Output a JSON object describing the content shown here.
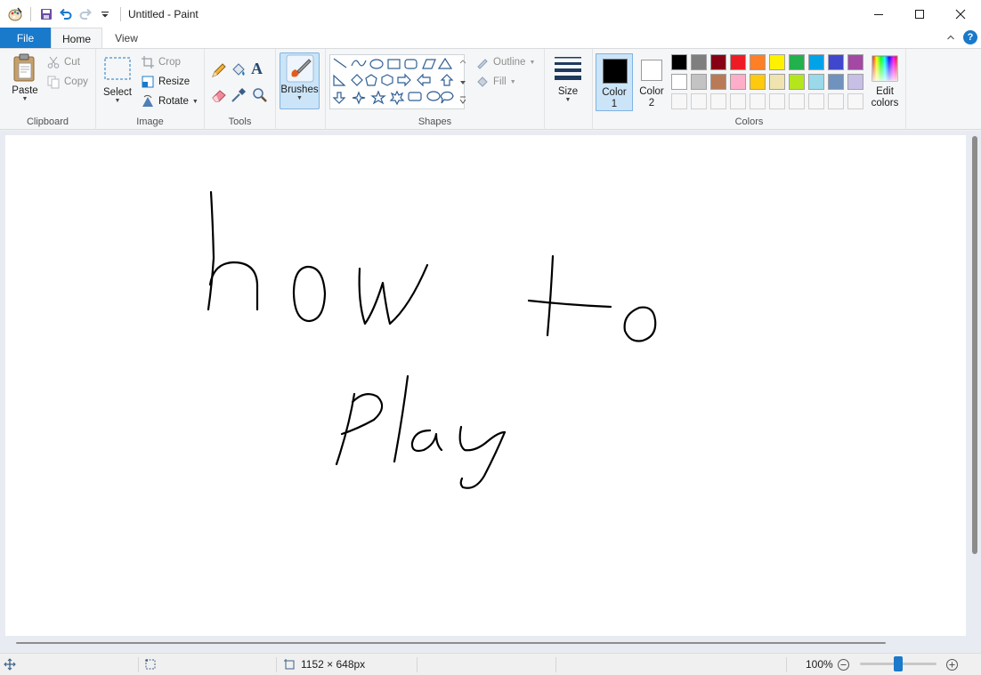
{
  "window": {
    "title": "Untitled - Paint"
  },
  "tabs": {
    "file": "File",
    "home": "Home",
    "view": "View"
  },
  "ribbon": {
    "clipboard": {
      "label": "Clipboard",
      "paste": "Paste",
      "cut": "Cut",
      "copy": "Copy"
    },
    "image": {
      "label": "Image",
      "select": "Select",
      "crop": "Crop",
      "resize": "Resize",
      "rotate": "Rotate"
    },
    "tools": {
      "label": "Tools"
    },
    "brushes": {
      "label": "Brushes"
    },
    "shapes": {
      "label": "Shapes",
      "outline": "Outline",
      "fill": "Fill"
    },
    "size": {
      "label": "Size"
    },
    "colors": {
      "label": "Colors",
      "color1_line1": "Color",
      "color1_line2": "1",
      "color2_line1": "Color",
      "color2_line2": "2",
      "edit_line1": "Edit",
      "edit_line2": "colors",
      "color1_value": "#000000",
      "color2_value": "#ffffff",
      "palette_row1": [
        "#000000",
        "#7f7f7f",
        "#880015",
        "#ed1c24",
        "#ff7f27",
        "#fff200",
        "#22b14c",
        "#00a2e8",
        "#3f48cc",
        "#a349a4"
      ],
      "palette_row2": [
        "#ffffff",
        "#c3c3c3",
        "#b97a57",
        "#ffaec9",
        "#ffc90e",
        "#efe4b0",
        "#b5e61d",
        "#99d9ea",
        "#7092be",
        "#c8bfe7"
      ]
    }
  },
  "status": {
    "canvas_size": "1152 × 648px",
    "zoom": "100%",
    "zoom_level": 0.5
  }
}
